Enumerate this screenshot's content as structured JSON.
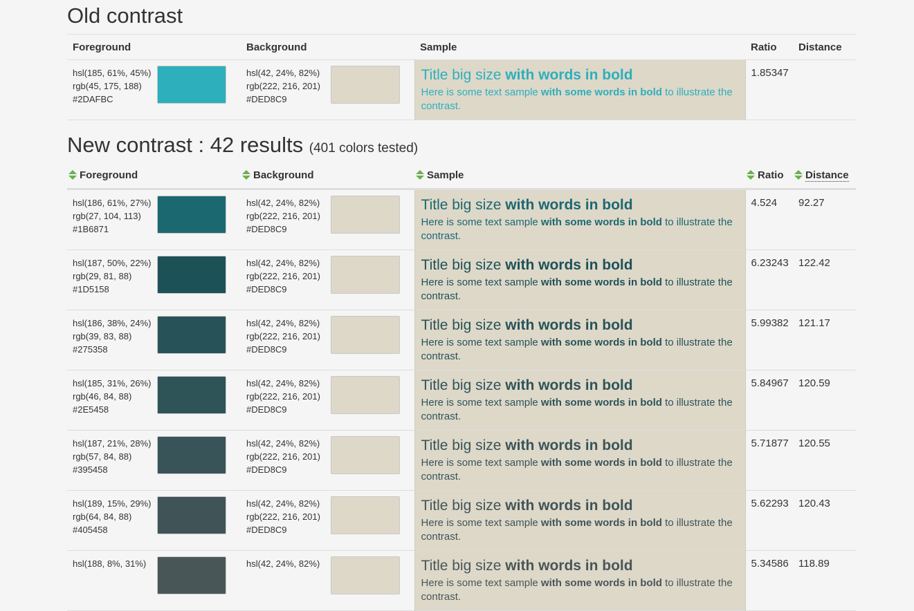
{
  "old": {
    "title": "Old contrast",
    "headers": {
      "foreground": "Foreground",
      "background": "Background",
      "sample": "Sample",
      "ratio": "Ratio",
      "distance": "Distance"
    },
    "row": {
      "fg_hsl": "hsl(185, 61%, 45%)",
      "fg_rgb": "rgb(45, 175, 188)",
      "fg_hex": "#2DAFBC",
      "fg_color": "#2DAFBC",
      "bg_hsl": "hsl(42, 24%, 82%)",
      "bg_rgb": "rgb(222, 216, 201)",
      "bg_hex": "#DED8C9",
      "bg_color": "#DED8C9",
      "ratio": "1.85347",
      "distance": ""
    }
  },
  "new": {
    "title": "New contrast : 42 results",
    "subtitle": "(401 colors tested)",
    "headers": {
      "foreground": "Foreground",
      "background": "Background",
      "sample": "Sample",
      "ratio": "Ratio",
      "distance": "Distance"
    },
    "rows": [
      {
        "fg_hsl": "hsl(186, 61%, 27%)",
        "fg_rgb": "rgb(27, 104, 113)",
        "fg_hex": "#1B6871",
        "fg_color": "#1B6871",
        "bg_hsl": "hsl(42, 24%, 82%)",
        "bg_rgb": "rgb(222, 216, 201)",
        "bg_hex": "#DED8C9",
        "bg_color": "#DED8C9",
        "ratio": "4.524",
        "distance": "92.27"
      },
      {
        "fg_hsl": "hsl(187, 50%, 22%)",
        "fg_rgb": "rgb(29, 81, 88)",
        "fg_hex": "#1D5158",
        "fg_color": "#1D5158",
        "bg_hsl": "hsl(42, 24%, 82%)",
        "bg_rgb": "rgb(222, 216, 201)",
        "bg_hex": "#DED8C9",
        "bg_color": "#DED8C9",
        "ratio": "6.23243",
        "distance": "122.42"
      },
      {
        "fg_hsl": "hsl(186, 38%, 24%)",
        "fg_rgb": "rgb(39, 83, 88)",
        "fg_hex": "#275358",
        "fg_color": "#275358",
        "bg_hsl": "hsl(42, 24%, 82%)",
        "bg_rgb": "rgb(222, 216, 201)",
        "bg_hex": "#DED8C9",
        "bg_color": "#DED8C9",
        "ratio": "5.99382",
        "distance": "121.17"
      },
      {
        "fg_hsl": "hsl(185, 31%, 26%)",
        "fg_rgb": "rgb(46, 84, 88)",
        "fg_hex": "#2E5458",
        "fg_color": "#2E5458",
        "bg_hsl": "hsl(42, 24%, 82%)",
        "bg_rgb": "rgb(222, 216, 201)",
        "bg_hex": "#DED8C9",
        "bg_color": "#DED8C9",
        "ratio": "5.84967",
        "distance": "120.59"
      },
      {
        "fg_hsl": "hsl(187, 21%, 28%)",
        "fg_rgb": "rgb(57, 84, 88)",
        "fg_hex": "#395458",
        "fg_color": "#395458",
        "bg_hsl": "hsl(42, 24%, 82%)",
        "bg_rgb": "rgb(222, 216, 201)",
        "bg_hex": "#DED8C9",
        "bg_color": "#DED8C9",
        "ratio": "5.71877",
        "distance": "120.55"
      },
      {
        "fg_hsl": "hsl(189, 15%, 29%)",
        "fg_rgb": "rgb(64, 84, 88)",
        "fg_hex": "#405458",
        "fg_color": "#405458",
        "bg_hsl": "hsl(42, 24%, 82%)",
        "bg_rgb": "rgb(222, 216, 201)",
        "bg_hex": "#DED8C9",
        "bg_color": "#DED8C9",
        "ratio": "5.62293",
        "distance": "120.43"
      },
      {
        "fg_hsl": "hsl(188, 8%, 31%)",
        "fg_rgb": "",
        "fg_hex": "",
        "fg_color": "#495658",
        "bg_hsl": "hsl(42, 24%, 82%)",
        "bg_rgb": "",
        "bg_hex": "",
        "bg_color": "#DED8C9",
        "ratio": "5.34586",
        "distance": "118.89"
      }
    ]
  },
  "sample": {
    "title_regular": "Title big size ",
    "title_bold": "with words in bold",
    "text_a": "Here is some text sample ",
    "text_bold": "with some words in bold",
    "text_b": " to illustrate the contrast."
  },
  "colors": {
    "sort_icon": "#6ab04c",
    "border": "#dddddd"
  },
  "icons": {
    "sort": "sort-arrows-icon"
  }
}
